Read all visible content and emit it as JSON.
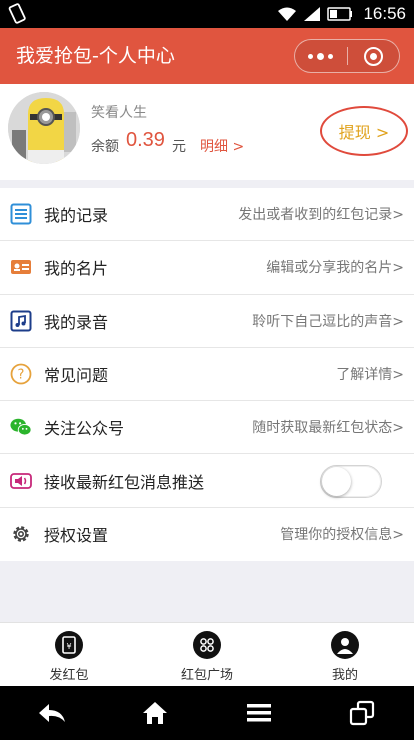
{
  "status_bar": {
    "time": "16:56"
  },
  "header": {
    "title": "我爱抢包-个人中心"
  },
  "profile": {
    "username": "笑看人生",
    "balance_label": "余额",
    "balance_amount": "0.39",
    "balance_unit": "元",
    "detail_link": "明细 >",
    "withdraw_label": "提现 >"
  },
  "menu": [
    {
      "icon": "list-icon",
      "label": "我的记录",
      "hint": "发出或者收到的红包记录>"
    },
    {
      "icon": "id-card-icon",
      "label": "我的名片",
      "hint": "编辑或分享我的名片>"
    },
    {
      "icon": "music-icon",
      "label": "我的录音",
      "hint": "聆听下自己逗比的声音>"
    },
    {
      "icon": "question-icon",
      "label": "常见问题",
      "hint": "了解详情>"
    },
    {
      "icon": "wechat-icon",
      "label": "关注公众号",
      "hint": "随时获取最新红包状态>"
    },
    {
      "icon": "speaker-icon",
      "label": "接收最新红包消息推送",
      "toggle_on": false
    },
    {
      "icon": "gear-icon",
      "label": "授权设置",
      "hint": "管理你的授权信息>"
    }
  ],
  "tabbar": [
    {
      "icon": "red-packet-icon",
      "label": "发红包"
    },
    {
      "icon": "grid-icon",
      "label": "红包广场"
    },
    {
      "icon": "user-icon",
      "label": "我的"
    }
  ],
  "colors": {
    "accent": "#e0553f",
    "withdraw_text": "#e0a21c"
  }
}
